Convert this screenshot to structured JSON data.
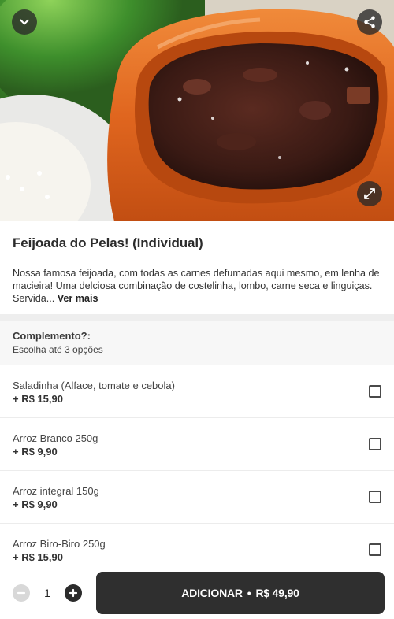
{
  "hero": {
    "collapse_icon": "chevron-down-icon",
    "share_icon": "share-icon",
    "expand_icon": "expand-icon"
  },
  "product": {
    "title": "Feijoada do Pelas! (Individual)",
    "description": "Nossa famosa feijoada, com todas as carnes defumadas aqui mesmo, em lenha de macieira! Uma delciosa combinação de costelinha, lombo, carne seca e linguiças. Servida...",
    "more_label": "Ver mais"
  },
  "group": {
    "title": "Complemento?:",
    "subtitle": "Escolha até 3 opções"
  },
  "options": [
    {
      "name": "Saladinha (Alface, tomate e cebola)",
      "price": "+ R$ 15,90",
      "checked": false
    },
    {
      "name": "Arroz Branco 250g",
      "price": "+ R$ 9,90",
      "checked": false
    },
    {
      "name": "Arroz integral 150g",
      "price": "+ R$ 9,90",
      "checked": false
    },
    {
      "name": "Arroz Biro-Biro 250g",
      "price": "+ R$ 15,90",
      "checked": false
    }
  ],
  "footer": {
    "quantity": "1",
    "add_label": "ADICIONAR",
    "separator": "•",
    "total": "R$ 49,90"
  },
  "colors": {
    "primary_button": "#2f2f2f",
    "clay_pot": "#e0661f",
    "stew": "#3a1d15"
  }
}
